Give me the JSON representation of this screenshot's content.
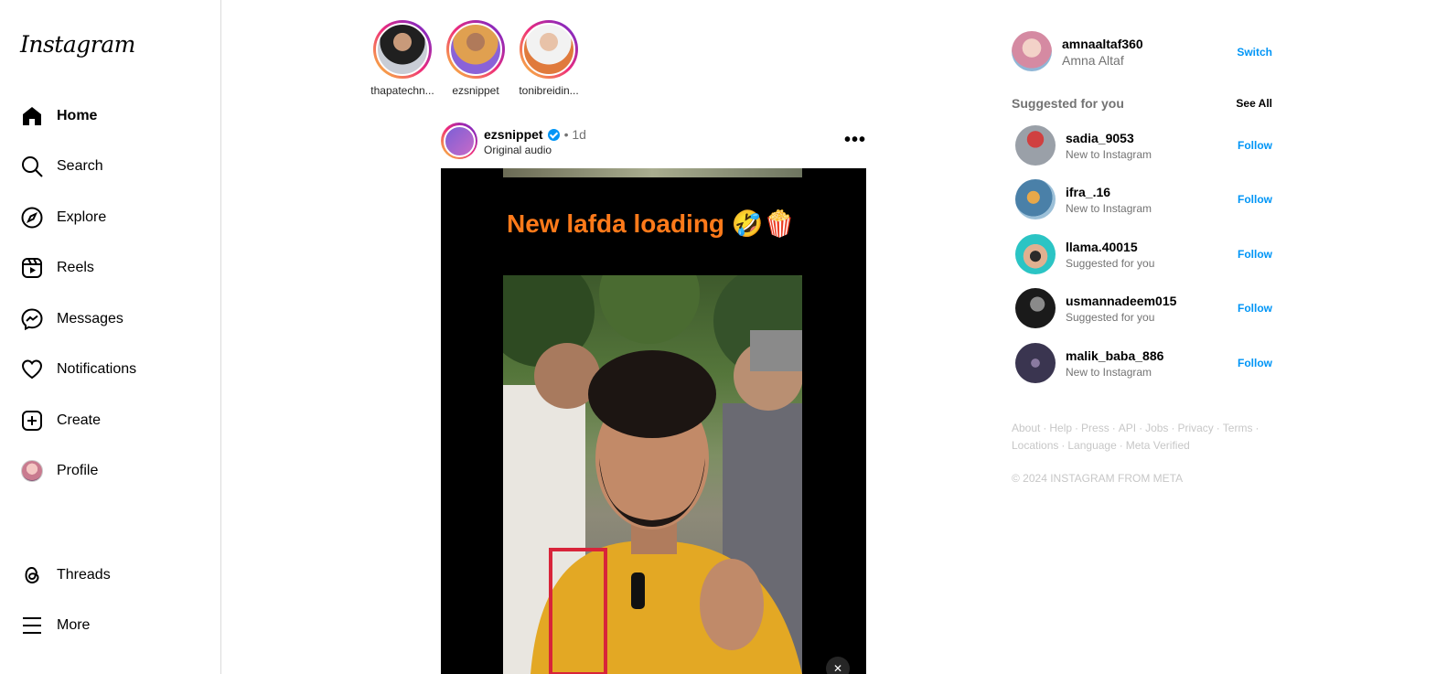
{
  "app": {
    "logo_text": "Instagram"
  },
  "sidebar": {
    "items": [
      {
        "label": "Home",
        "icon": "home-icon",
        "active": true
      },
      {
        "label": "Search",
        "icon": "search-icon"
      },
      {
        "label": "Explore",
        "icon": "compass-icon"
      },
      {
        "label": "Reels",
        "icon": "reels-icon"
      },
      {
        "label": "Messages",
        "icon": "messenger-icon"
      },
      {
        "label": "Notifications",
        "icon": "heart-icon"
      },
      {
        "label": "Create",
        "icon": "plus-square-icon"
      },
      {
        "label": "Profile",
        "icon": "profile-avatar"
      }
    ],
    "bottom": [
      {
        "label": "Threads",
        "icon": "threads-icon"
      },
      {
        "label": "More",
        "icon": "hamburger-icon"
      }
    ]
  },
  "stories": [
    {
      "name": "thapatechn...",
      "color": "#c9cdd6"
    },
    {
      "name": "ezsnippet",
      "color": "#8a62d8"
    },
    {
      "name": "tonibreidin...",
      "color": "#e07a3c"
    }
  ],
  "post": {
    "username": "ezsnippet",
    "verified": true,
    "time": "• 1d",
    "audio": "Original audio",
    "caption_overlay": "New lafda loading 🤣🍿"
  },
  "me": {
    "username": "amnaaltaf360",
    "name": "Amna Altaf",
    "switch_label": "Switch"
  },
  "suggestions": {
    "title": "Suggested for you",
    "see_all": "See All",
    "follow_label": "Follow",
    "items": [
      {
        "username": "sadia_9053",
        "sub": "New to Instagram",
        "color": "#b85050"
      },
      {
        "username": "ifra_.16",
        "sub": "New to Instagram",
        "color": "#6f9fc4"
      },
      {
        "username": "llama.40015",
        "sub": "Suggested for you",
        "color": "#2bc4c4"
      },
      {
        "username": "usmannadeem015",
        "sub": "Suggested for you",
        "color": "#2a2a2a"
      },
      {
        "username": "malik_baba_886",
        "sub": "New to Instagram",
        "color": "#3a3550"
      }
    ]
  },
  "footer": {
    "links": [
      "About",
      "Help",
      "Press",
      "API",
      "Jobs",
      "Privacy",
      "Terms",
      "Locations",
      "Language",
      "Meta Verified"
    ],
    "copyright": "© 2024 INSTAGRAM FROM META"
  }
}
